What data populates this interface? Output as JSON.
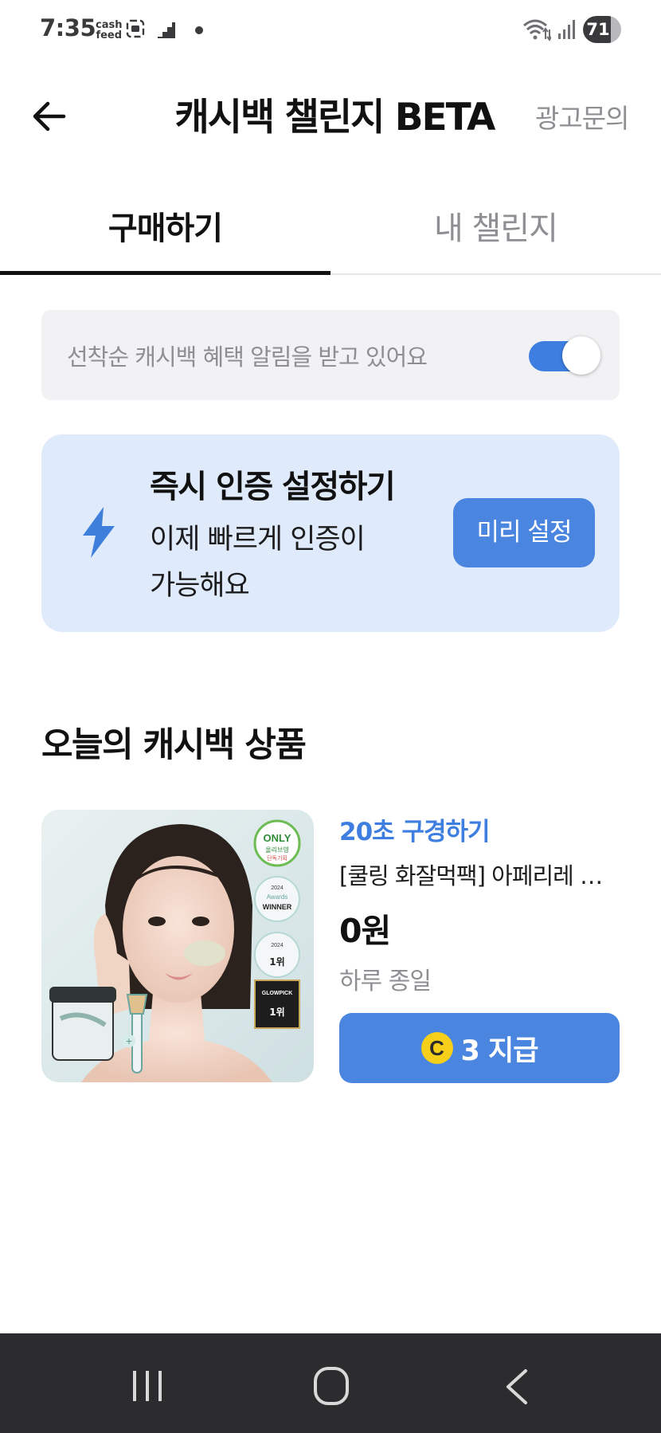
{
  "status_bar": {
    "time": "7:35",
    "app_label_line1": "cash",
    "app_label_line2": "feed",
    "battery": "71"
  },
  "header": {
    "title": "캐시백 챌린지 BETA",
    "ad_inquiry": "광고문의"
  },
  "tabs": [
    {
      "label": "구매하기",
      "active": true
    },
    {
      "label": "내 챌린지",
      "active": false
    }
  ],
  "notice": {
    "text": "선착순 캐시백 혜택 알림을 받고 있어요",
    "toggle_on": true
  },
  "verify_card": {
    "title": "즉시 인증 설정하기",
    "desc_line1": "이제 빠르게 인증이",
    "desc_line2": "가능해요",
    "button_label": "미리 설정"
  },
  "section": {
    "title": "오늘의 캐시백 상품"
  },
  "product": {
    "tag": "20초 구경하기",
    "name": "[쿨링 화잘먹팩] 아페리레 …",
    "price": "0원",
    "duration": "하루 종일",
    "reward_coin": "C",
    "reward_text": "3 지급",
    "badges": {
      "only": "ONLY",
      "only_sub": "올리브영",
      "only_sub2": "단독기획",
      "awards_year": "2024",
      "awards_name": "Awards",
      "awards_winner": "WINNER",
      "awards_rank": "1위",
      "glowpick": "GLOWPICK"
    }
  },
  "colors": {
    "accent": "#4a85e0",
    "tag_blue": "#3d7ee0",
    "card_bg": "#dfeafb",
    "nav_bg": "#2c2c2e"
  }
}
